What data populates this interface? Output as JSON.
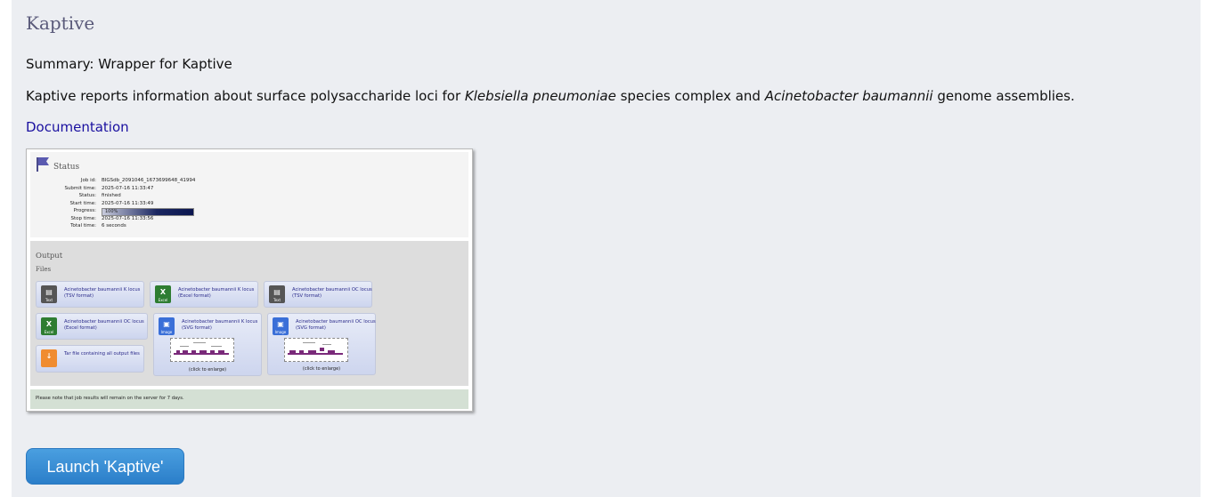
{
  "tool": {
    "title": "Kaptive",
    "summary": "Summary: Wrapper for Kaptive",
    "description_parts": {
      "p1": "Kaptive reports information about surface polysaccharide loci for ",
      "sp1": "Klebsiella pneumoniae",
      "p2": " species complex and ",
      "sp2": "Acinetobacter baumannii",
      "p3": " genome assemblies."
    },
    "documentation_link": "Documentation",
    "launch_button": "Launch 'Kaptive'"
  },
  "screenshot": {
    "status_heading": "Status",
    "fields": [
      {
        "key": "Job id:",
        "value": "BIGSdb_2091046_1673699648_41994"
      },
      {
        "key": "Submit time:",
        "value": "2025-07-16 11:33:47"
      },
      {
        "key": "Status:",
        "value": "finished"
      },
      {
        "key": "Start time:",
        "value": "2025-07-16 11:33:49"
      },
      {
        "key": "Progress:",
        "value": "100%"
      },
      {
        "key": "Stop time:",
        "value": "2025-07-16 11:33:56"
      },
      {
        "key": "Total time:",
        "value": "6 seconds"
      }
    ],
    "output_heading": "Output",
    "files_heading": "Files",
    "files": [
      {
        "label": "Acinetobacter baumannii K locus (TSV format)",
        "type": "Text",
        "color": "#555555"
      },
      {
        "label": "Acinetobacter baumannii K locus (Excel format)",
        "type": "Excel",
        "color": "#2e7d32"
      },
      {
        "label": "Acinetobacter baumannii OC locus (TSV format)",
        "type": "Text",
        "color": "#555555"
      },
      {
        "label": "Acinetobacter baumannii OC locus (Excel format)",
        "type": "Excel",
        "color": "#2e7d32"
      },
      {
        "label": "Acinetobacter baumannii K locus (SVG format)",
        "type": "Image",
        "color": "#3a6fd8",
        "enlarge": "(click to enlarge)"
      },
      {
        "label": "Acinetobacter baumannii OC locus (SVG format)",
        "type": "Image",
        "color": "#3a6fd8",
        "enlarge": "(click to enlarge)"
      },
      {
        "label": "Tar file containing all output files",
        "type": "",
        "color": "#f08c30"
      }
    ],
    "note": "Please note that job results will remain on the server for 7 days."
  }
}
